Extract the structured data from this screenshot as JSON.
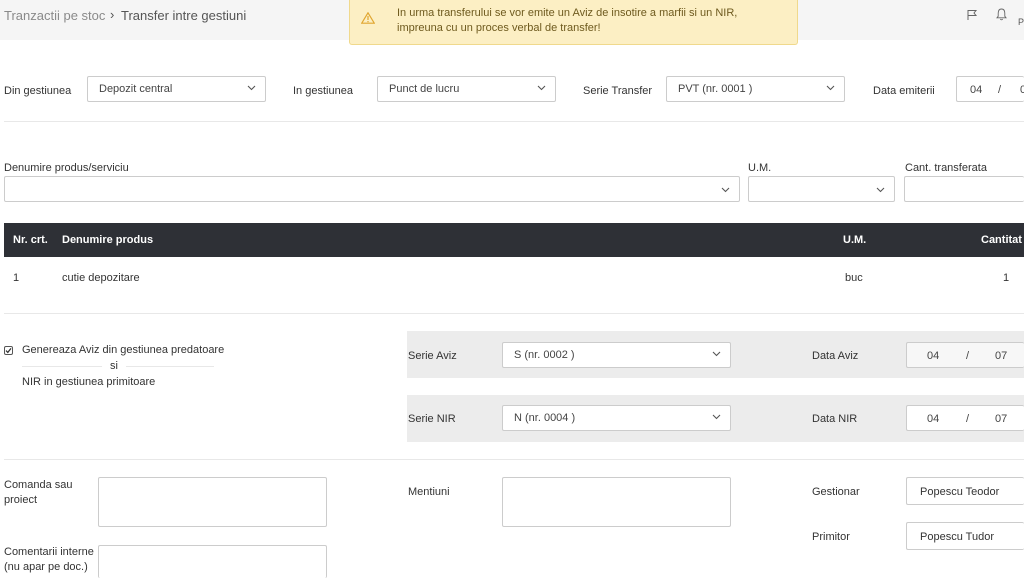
{
  "breadcrumb": {
    "parent": "Tranzactii pe stoc",
    "separator": "›",
    "current": "Transfer intre gestiuni"
  },
  "alert": {
    "line1": "In urma transferului se vor emite un Aviz de insotire a marfii si un NIR,",
    "line2": "impreuna cu un proces verbal de transfer!"
  },
  "header": {
    "user_initial": "P"
  },
  "form": {
    "din_gestiunea": {
      "label": "Din gestiunea",
      "value": "Depozit central"
    },
    "in_gestiunea": {
      "label": "In gestiunea",
      "value": "Punct de lucru"
    },
    "serie_transfer": {
      "label": "Serie Transfer",
      "value": "PVT (nr. 0001 )"
    },
    "data_emiterii": {
      "label": "Data emiterii",
      "day": "04",
      "sep": "/",
      "month": "0"
    }
  },
  "product_entry": {
    "name_label": "Denumire produs/serviciu",
    "um_label": "U.M.",
    "qty_label": "Cant. transferata"
  },
  "table": {
    "headers": {
      "nr": "Nr. crt.",
      "name": "Denumire produs",
      "um": "U.M.",
      "qty": "Cantitat"
    },
    "rows": [
      {
        "nr": "1",
        "name": "cutie depozitare",
        "um": "buc",
        "qty": "1"
      }
    ]
  },
  "options": {
    "checkbox_label": "Genereaza Aviz din gestiunea predatoare",
    "si": "si",
    "nir_label": "NIR in gestiunea primitoare",
    "checked": true
  },
  "aviz": {
    "serie_label": "Serie Aviz",
    "serie_value": "S (nr. 0002 )",
    "date_label": "Data Aviz",
    "day": "04",
    "sep": "/",
    "month": "07"
  },
  "nir": {
    "serie_label": "Serie NIR",
    "serie_value": "N (nr. 0004 )",
    "date_label": "Data NIR",
    "day": "04",
    "sep": "/",
    "month": "07"
  },
  "bottom": {
    "comanda_label_1": "Comanda sau",
    "comanda_label_2": "proiect",
    "mentiuni_label": "Mentiuni",
    "gestionar_label": "Gestionar",
    "gestionar_value": "Popescu Teodor",
    "primitor_label": "Primitor",
    "primitor_value": "Popescu Tudor",
    "comentarii_label_1": "Comentarii interne",
    "comentarii_label_2": "(nu apar pe doc.)"
  },
  "colors": {
    "table_header": "#2e3036",
    "alert_bg": "#fcefc4",
    "alert_icon": "#e0a630"
  }
}
